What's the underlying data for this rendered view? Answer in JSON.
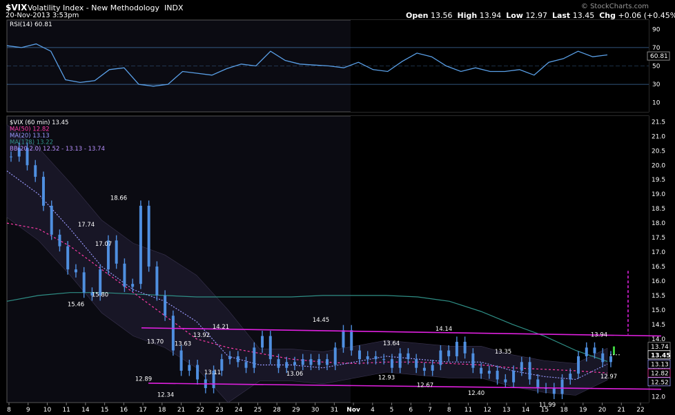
{
  "header": {
    "symbol": "$VIX",
    "name": "Volatility Index - New Methodology",
    "exchange": "INDX",
    "datetime": "20-Nov-2013 3:53pm",
    "open_label": "Open",
    "open": "13.56",
    "high_label": "High",
    "high": "13.94",
    "low_label": "Low",
    "low": "12.97",
    "last_label": "Last",
    "last": "13.45",
    "chg_label": "Chg",
    "chg": "+0.06 (+0.45%)",
    "watermark": "© StockCharts.com"
  },
  "rsi_panel": {
    "legend": "RSI(14) 60.81",
    "current_label": "60.81",
    "ticks": [
      "90",
      "70",
      "50",
      "30",
      "10"
    ]
  },
  "price_legend": {
    "main": "$VIX (60 min) 13.45",
    "ma50": "MA(50) 12.82",
    "ma20": "MA(20) 13.13",
    "ma178": "MA(178) 13.22",
    "bb": "BB(20,2.0) 12.52 - 13.13 - 13.74"
  },
  "colors": {
    "price": "#4f8fe0",
    "rsi": "#5aa0e8",
    "ma50": "#ff3aa8",
    "ma20": "#9a9aff",
    "ma178": "#2f8f86",
    "channel": "#e020e0",
    "bb_fill": "#181626",
    "highlight": "#0d0d14"
  },
  "y_ticks": [
    "21.5",
    "21.0",
    "20.5",
    "20.0",
    "19.5",
    "19.0",
    "18.5",
    "18.0",
    "17.5",
    "17.0",
    "16.5",
    "16.0",
    "15.5",
    "15.0",
    "14.5",
    "14.0",
    "13.5",
    "13.0",
    "12.5",
    "12.0"
  ],
  "right_labels": {
    "bb_upper": "13.74",
    "last": "13.45",
    "ma20": "13.13",
    "ma50": "12.82",
    "bb_lower": "12.52"
  },
  "x_labels": [
    "8",
    "9",
    "10",
    "11",
    "14",
    "15",
    "16",
    "17",
    "18",
    "21",
    "22",
    "23",
    "24",
    "25",
    "28",
    "29",
    "30",
    "31",
    "Nov",
    "4",
    "5",
    "6",
    "7",
    "8",
    "11",
    "12",
    "13",
    "14",
    "15",
    "18",
    "19",
    "20",
    "21",
    "22"
  ],
  "chart_data": {
    "type": "line",
    "title": "$VIX Volatility Index - New Methodology INDX",
    "annotations": [
      {
        "label": "18.66",
        "value": 18.66
      },
      {
        "label": "17.74",
        "value": 17.74
      },
      {
        "label": "17.07",
        "value": 17.07
      },
      {
        "label": "15.46",
        "value": 15.46
      },
      {
        "label": "15.80",
        "value": 15.8
      },
      {
        "label": "13.70",
        "value": 13.7
      },
      {
        "label": "12.89",
        "value": 12.89
      },
      {
        "label": "12.34",
        "value": 12.34
      },
      {
        "label": "13.63",
        "value": 13.63
      },
      {
        "label": "13.92",
        "value": 13.92
      },
      {
        "label": "14.21",
        "value": 14.21
      },
      {
        "label": "13.11",
        "value": 13.11
      },
      {
        "label": "13.06",
        "value": 13.06
      },
      {
        "label": "14.45",
        "value": 14.45
      },
      {
        "label": "13.64",
        "value": 13.64
      },
      {
        "label": "12.93",
        "value": 12.93
      },
      {
        "label": "14.14",
        "value": 14.14
      },
      {
        "label": "12.67",
        "value": 12.67
      },
      {
        "label": "12.40",
        "value": 12.4
      },
      {
        "label": "13.35",
        "value": 13.35
      },
      {
        "label": "11.99",
        "value": 11.99
      },
      {
        "label": "13.94",
        "value": 13.94
      },
      {
        "label": "12.97",
        "value": 12.97
      }
    ],
    "ylim": [
      11.8,
      21.7
    ],
    "rsi_ylim": [
      0,
      100
    ],
    "series": [
      {
        "name": "$VIX (60 min)",
        "values": [
          20.3,
          20.6,
          20.0,
          19.6,
          18.6,
          17.6,
          17.2,
          16.4,
          16.3,
          15.6,
          15.5,
          16.4,
          17.4,
          16.6,
          15.8,
          15.9,
          18.6,
          16.5,
          15.5,
          14.8,
          13.6,
          12.9,
          13.1,
          12.6,
          12.3,
          12.9,
          13.3,
          13.4,
          13.2,
          13.0,
          13.7,
          14.1,
          13.3,
          13.0,
          13.2,
          13.1,
          13.3,
          13.1,
          13.3,
          13.1,
          13.7,
          14.3,
          13.6,
          13.3,
          13.4,
          13.3,
          13.3,
          13.0,
          13.5,
          13.3,
          13.0,
          12.9,
          13.1,
          13.6,
          13.4,
          13.9,
          13.5,
          13.0,
          12.8,
          12.9,
          12.6,
          12.5,
          12.9,
          13.2,
          12.6,
          12.3,
          12.3,
          12.1,
          12.6,
          12.8,
          13.4,
          13.7,
          13.5,
          13.2,
          13.4
        ]
      },
      {
        "name": "MA(50)",
        "values": [
          18.0,
          17.8,
          17.2,
          16.4,
          15.6,
          14.8,
          14.0,
          13.7,
          13.5,
          13.3,
          13.2,
          13.15,
          13.2,
          13.2,
          13.15,
          13.1,
          13.0,
          12.95,
          12.9,
          12.82
        ]
      },
      {
        "name": "MA(20)",
        "values": [
          19.8,
          19.0,
          17.8,
          16.5,
          15.7,
          15.3,
          14.6,
          13.4,
          13.1,
          13.1,
          13.0,
          13.2,
          13.4,
          13.3,
          13.2,
          13.2,
          12.9,
          12.7,
          12.6,
          13.13
        ]
      },
      {
        "name": "MA(178)",
        "values": [
          15.3,
          15.5,
          15.6,
          15.6,
          15.55,
          15.5,
          15.45,
          15.45,
          15.45,
          15.45,
          15.5,
          15.5,
          15.5,
          15.45,
          15.3,
          14.95,
          14.5,
          14.1,
          13.6,
          13.22
        ]
      },
      {
        "name": "RSI(14)",
        "values": [
          72,
          70,
          74,
          66,
          35,
          32,
          34,
          46,
          48,
          30,
          28,
          30,
          44,
          42,
          40,
          47,
          52,
          50,
          66,
          56,
          52,
          51,
          50,
          48,
          54,
          46,
          44,
          55,
          64,
          60,
          50,
          44,
          48,
          44,
          44,
          46,
          40,
          54,
          58,
          66,
          60,
          62
        ]
      }
    ]
  }
}
